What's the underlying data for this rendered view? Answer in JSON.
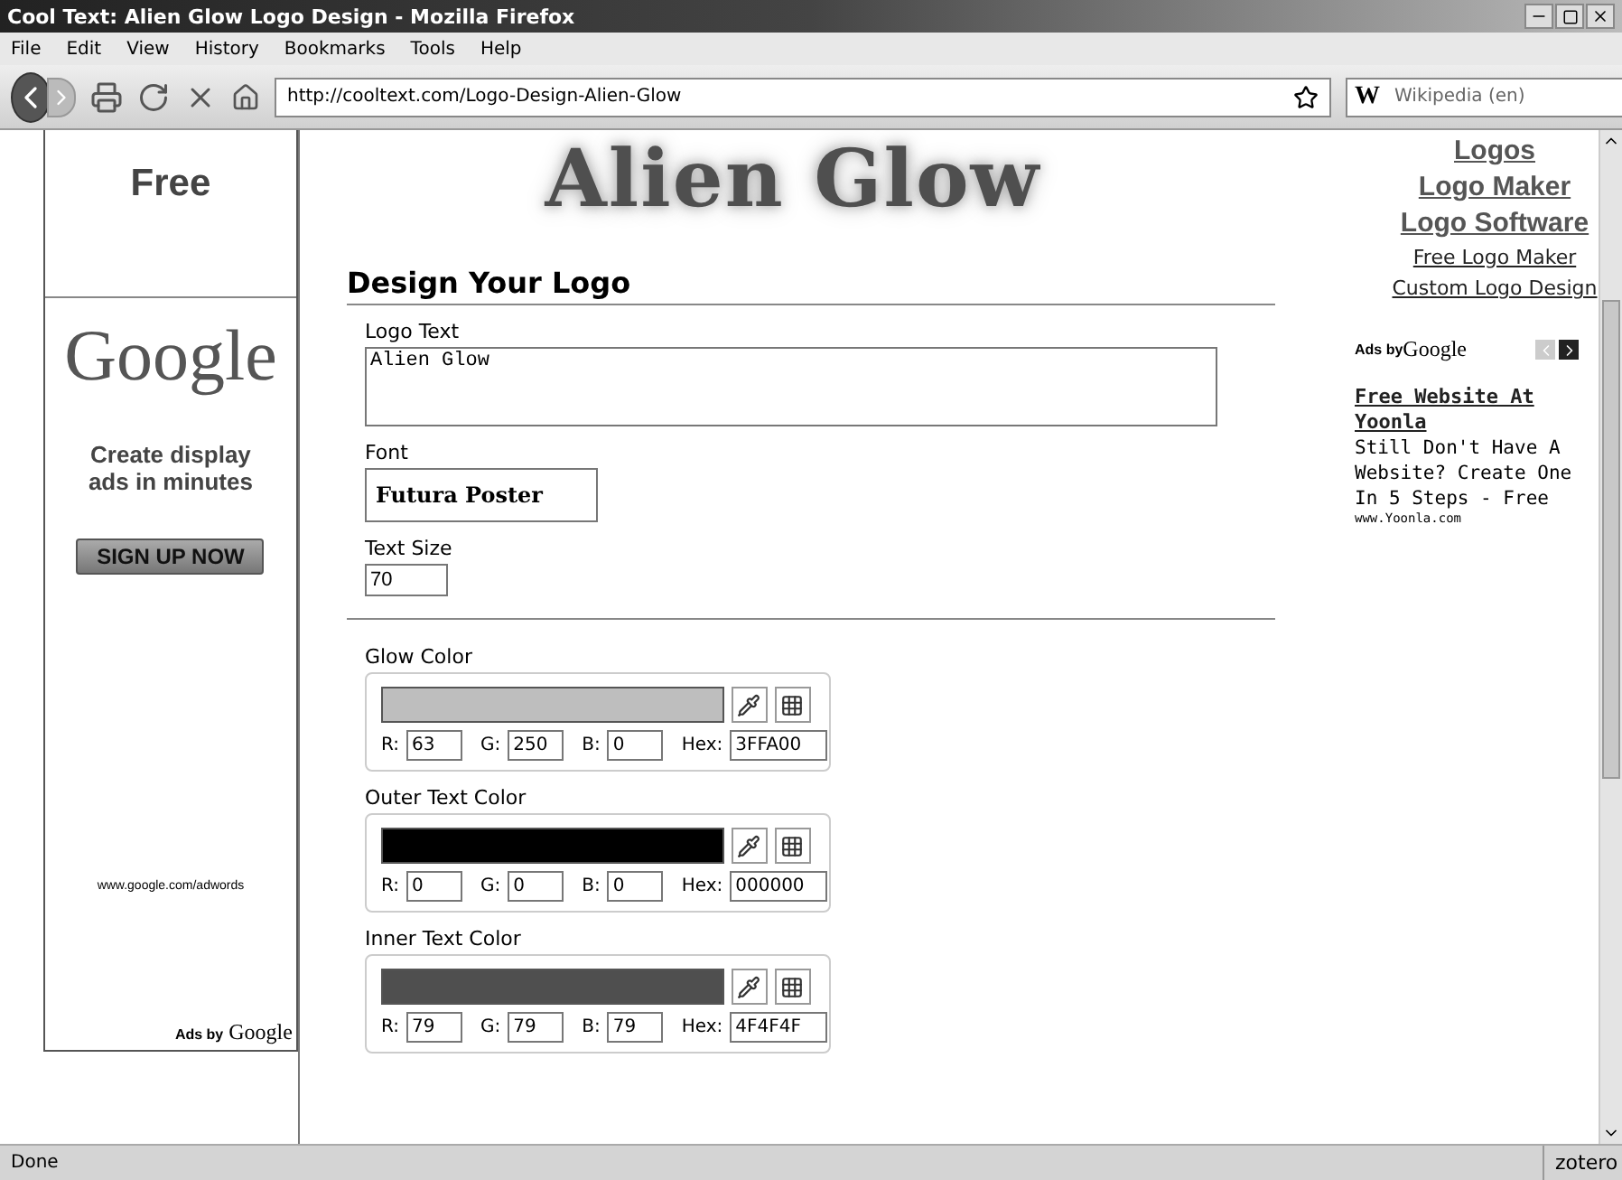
{
  "window": {
    "title": "Cool Text: Alien Glow Logo Design - Mozilla Firefox"
  },
  "menu": [
    "File",
    "Edit",
    "View",
    "History",
    "Bookmarks",
    "Tools",
    "Help"
  ],
  "toolbar": {
    "url": "http://cooltext.com/Logo-Design-Alien-Glow",
    "search_placeholder": "Wikipedia (en)",
    "search_engine": "W"
  },
  "left_ad": {
    "top_text": "Free",
    "logo": "Google",
    "headline": "Create display ads in minutes",
    "button": "SIGN UP NOW",
    "url": "www.google.com/adwords",
    "ads_by": "Ads by",
    "ads_brand": "Google"
  },
  "main": {
    "logo_title": "Alien Glow",
    "heading": "Design Your Logo",
    "logo_text": {
      "label": "Logo Text",
      "value": "Alien Glow"
    },
    "font": {
      "label": "Font",
      "value": "Futura Poster"
    },
    "text_size": {
      "label": "Text Size",
      "value": "70"
    },
    "colors": [
      {
        "label": "Glow Color",
        "color": "#bebebe",
        "fields": [
          {
            "label": "R:",
            "value": "63"
          },
          {
            "label": "G:",
            "value": "250"
          },
          {
            "label": "B:",
            "value": "0"
          },
          {
            "label": "Hex:",
            "value": "3FFA00"
          }
        ]
      },
      {
        "label": "Outer Text Color",
        "color": "#000000",
        "fields": [
          {
            "label": "R:",
            "value": "0"
          },
          {
            "label": "G:",
            "value": "0"
          },
          {
            "label": "B:",
            "value": "0"
          },
          {
            "label": "Hex:",
            "value": "000000"
          }
        ]
      },
      {
        "label": "Inner Text Color",
        "color": "#4f4f4f",
        "fields": [
          {
            "label": "R:",
            "value": "79"
          },
          {
            "label": "G:",
            "value": "79"
          },
          {
            "label": "B:",
            "value": "79"
          },
          {
            "label": "Hex:",
            "value": "4F4F4F"
          }
        ]
      }
    ]
  },
  "right": {
    "big_links": [
      "Logos",
      "Logo Maker",
      "Logo Software"
    ],
    "small_links": [
      "Free Logo Maker",
      "Custom Logo Design"
    ],
    "ads_by": "Ads by",
    "ads_brand": "Google",
    "ad_title": "Free Website At Yoonla",
    "ad_body": "Still Don't Have A Website? Create One In 5 Steps - Free",
    "ad_url": "www.Yoonla.com"
  },
  "status_bar": {
    "text": "Done",
    "addon": "zotero"
  }
}
